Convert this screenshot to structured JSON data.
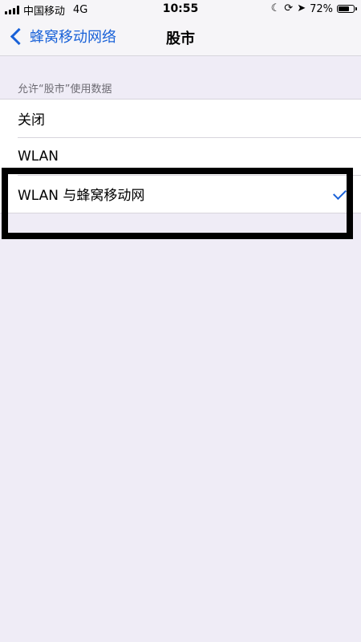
{
  "status_bar": {
    "carrier": "中国移动",
    "network": "4G",
    "time": "10:55",
    "icons": [
      "moon-icon",
      "orientation-lock-icon",
      "location-arrow-icon"
    ],
    "battery_percent": "72%",
    "battery_level": 0.72
  },
  "nav": {
    "back_label": "蜂窝移动网络",
    "title": "股市"
  },
  "section": {
    "header": "允许“股市”使用数据",
    "options": [
      {
        "label": "关闭",
        "selected": false
      },
      {
        "label": "WLAN",
        "selected": false
      },
      {
        "label": "WLAN 与蜂窝移动网",
        "selected": true
      }
    ]
  },
  "colors": {
    "accent": "#1a62d8",
    "background": "#efecf6",
    "highlight_border": "#000000"
  }
}
